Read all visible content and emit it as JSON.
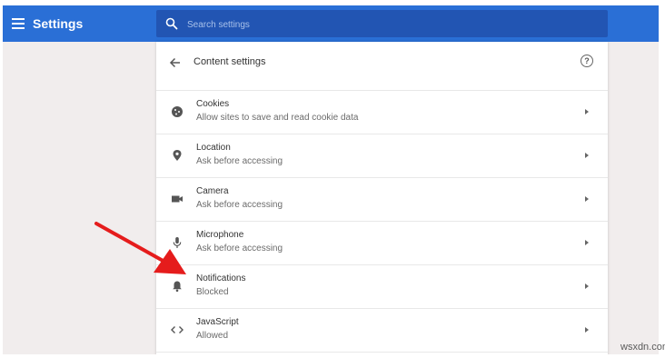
{
  "header": {
    "app_title": "Settings",
    "search": {
      "placeholder": "Search settings",
      "value": ""
    }
  },
  "card": {
    "title": "Content settings",
    "rows": [
      {
        "label": "Cookies",
        "sub": "Allow sites to save and read cookie data",
        "icon": "cookie-icon"
      },
      {
        "label": "Location",
        "sub": "Ask before accessing",
        "icon": "location-pin-icon"
      },
      {
        "label": "Camera",
        "sub": "Ask before accessing",
        "icon": "camera-icon"
      },
      {
        "label": "Microphone",
        "sub": "Ask before accessing",
        "icon": "microphone-icon"
      },
      {
        "label": "Notifications",
        "sub": "Blocked",
        "icon": "bell-icon"
      },
      {
        "label": "JavaScript",
        "sub": "Allowed",
        "icon": "code-icon"
      }
    ]
  },
  "watermark": "wsxdn.com",
  "colors": {
    "topbar": "#2a6fd6",
    "search_box": "#2255b3",
    "annotation_arrow": "#e51c1c",
    "background": "#f1eded"
  }
}
